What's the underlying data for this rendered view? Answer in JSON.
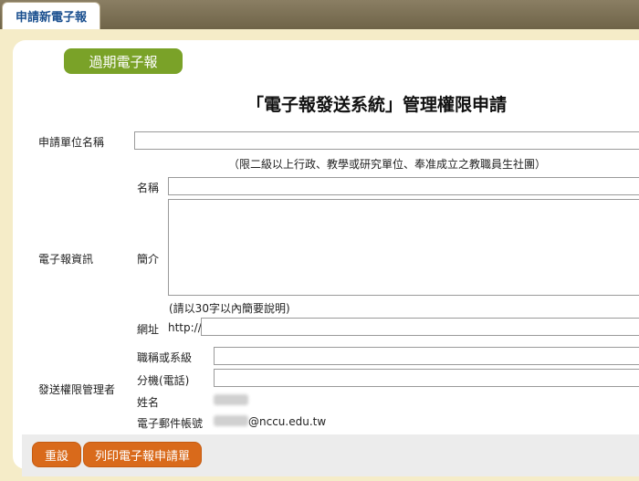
{
  "tab": {
    "label": "申請新電子報"
  },
  "past_button": {
    "label": "過期電子報"
  },
  "title": "「電子報發送系統」管理權限申請",
  "form": {
    "unit_name_label": "申請單位名稱",
    "unit_note": "（限二級以上行政、教學或研究單位、奉准成立之教職員生社團）",
    "newsletter_info_label": "電子報資訊",
    "name_label": "名稱",
    "intro_label": "簡介",
    "intro_note": "(請以30字以內簡要說明)",
    "url_label": "網址",
    "url_prefix": "http://",
    "admin_label": "發送權限管理者",
    "title_label": "職稱或系級",
    "ext_label": "分機(電話)",
    "person_name_label": "姓名",
    "email_label": "電子郵件帳號",
    "email_domain": "@nccu.edu.tw"
  },
  "buttons": {
    "reset": "重設",
    "print": "列印電子報申請單"
  },
  "colors": {
    "topbar": "#7a6e52",
    "panel": "#f5ecc8",
    "green": "#7aa228",
    "orange": "#d96a1b",
    "tab_text": "#1a4f8f"
  }
}
